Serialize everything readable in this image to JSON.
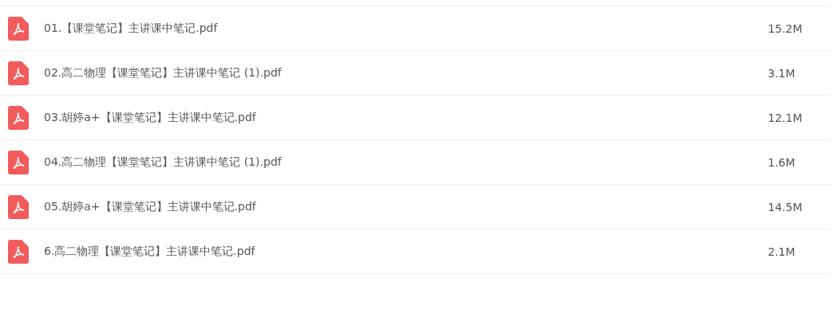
{
  "files": [
    {
      "name": "01.【课堂笔记】主讲课中笔记.pdf",
      "size": "15.2M"
    },
    {
      "name": "02.高二物理【课堂笔记】主讲课中笔记 (1).pdf",
      "size": "3.1M"
    },
    {
      "name": "03.胡婷a+【课堂笔记】主讲课中笔记.pdf",
      "size": "12.1M"
    },
    {
      "name": "04.高二物理【课堂笔记】主讲课中笔记 (1).pdf",
      "size": "1.6M"
    },
    {
      "name": "05.胡婷a+【课堂笔记】主讲课中笔记.pdf",
      "size": "14.5M"
    },
    {
      "name": "6.高二物理【课堂笔记】主讲课中笔记.pdf",
      "size": "2.1M"
    }
  ]
}
